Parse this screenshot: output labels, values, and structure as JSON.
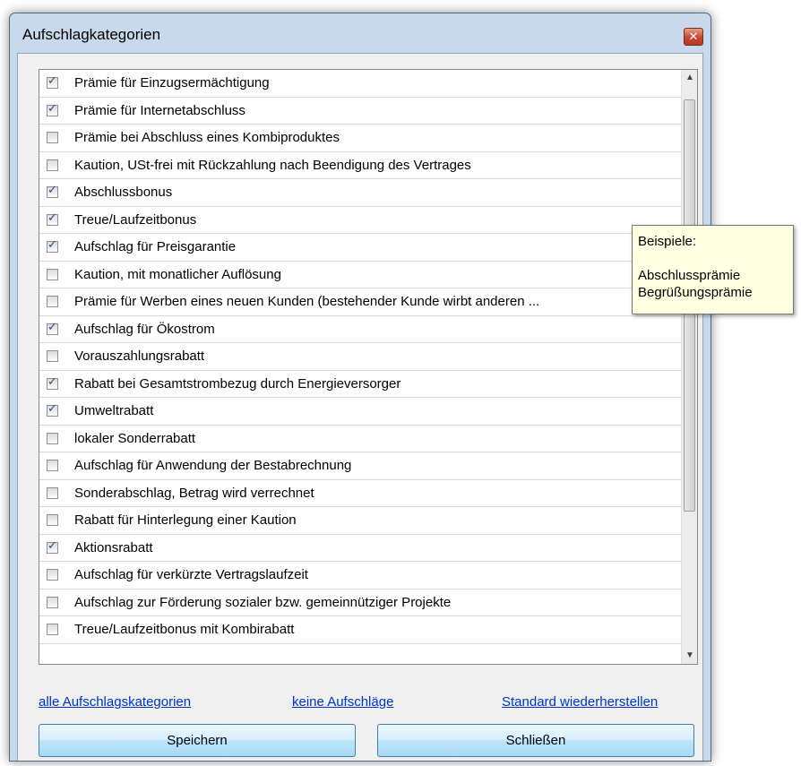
{
  "window": {
    "title": "Aufschlagkategorien",
    "close_glyph": "✕"
  },
  "list": {
    "items": [
      {
        "label": "Prämie für Einzugsermächtigung",
        "checked": true
      },
      {
        "label": "Prämie für Internetabschluss",
        "checked": true
      },
      {
        "label": "Prämie bei Abschluss eines Kombiproduktes",
        "checked": false
      },
      {
        "label": "Kaution, USt-frei mit Rückzahlung nach Beendigung des Vertrages",
        "checked": false
      },
      {
        "label": "Abschlussbonus",
        "checked": true
      },
      {
        "label": "Treue/Laufzeitbonus",
        "checked": true
      },
      {
        "label": "Aufschlag für Preisgarantie",
        "checked": true
      },
      {
        "label": "Kaution, mit monatlicher Auflösung",
        "checked": false
      },
      {
        "label": "Prämie für Werben eines neuen Kunden (bestehender Kunde wirbt anderen ...",
        "checked": false
      },
      {
        "label": "Aufschlag für Ökostrom",
        "checked": true
      },
      {
        "label": "Vorauszahlungsrabatt",
        "checked": false
      },
      {
        "label": "Rabatt bei Gesamtstrombezug durch Energieversorger",
        "checked": true
      },
      {
        "label": "Umweltrabatt",
        "checked": true
      },
      {
        "label": "lokaler Sonderrabatt",
        "checked": false
      },
      {
        "label": "Aufschlag für Anwendung der Bestabrechnung",
        "checked": false
      },
      {
        "label": "Sonderabschlag, Betrag wird verrechnet",
        "checked": false
      },
      {
        "label": "Rabatt für Hinterlegung einer Kaution",
        "checked": false
      },
      {
        "label": "Aktionsrabatt",
        "checked": true
      },
      {
        "label": "Aufschlag für verkürzte Vertragslaufzeit",
        "checked": false
      },
      {
        "label": "Aufschlag zur Förderung sozialer bzw. gemeinnütziger Projekte",
        "checked": false
      },
      {
        "label": "Treue/Laufzeitbonus mit Kombirabatt",
        "checked": false
      }
    ],
    "scroll_up_glyph": "▲",
    "scroll_down_glyph": "▼"
  },
  "tooltip": {
    "heading": "Beispiele:",
    "line1": "Abschlussprämie",
    "line2": "Begrüßungsprämie"
  },
  "links": {
    "all": "alle Aufschlagskategorien",
    "none": "keine Aufschläge",
    "reset": "Standard wiederherstellen"
  },
  "buttons": {
    "save": "Speichern",
    "close": "Schließen"
  },
  "colors": {
    "link": "#0033cc",
    "title_bar": "#c9d9ec",
    "tooltip_bg": "#ffffe1",
    "close_button": "#c8472d"
  }
}
